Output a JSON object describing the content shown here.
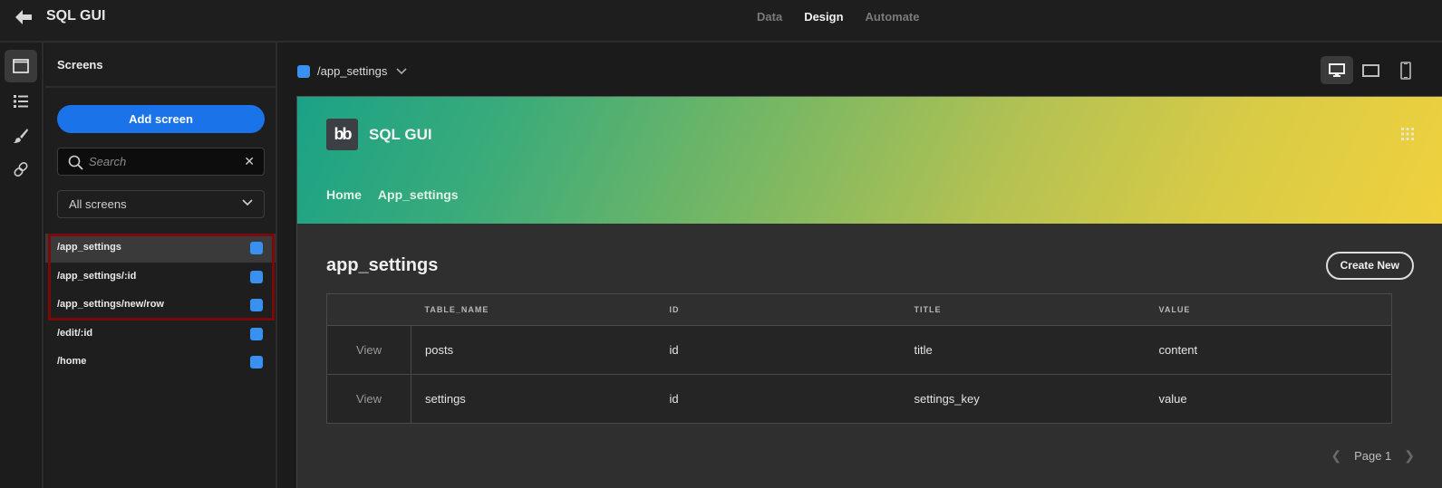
{
  "topbar": {
    "app_title": "SQL GUI",
    "tabs": [
      {
        "label": "Data",
        "active": false
      },
      {
        "label": "Design",
        "active": true
      },
      {
        "label": "Automate",
        "active": false
      }
    ]
  },
  "icon_rail": [
    "screens-icon",
    "components-list-icon",
    "theme-brush-icon",
    "link-icon"
  ],
  "screens_panel": {
    "title": "Screens",
    "add_button": "Add screen",
    "search": {
      "placeholder": "Search",
      "value": ""
    },
    "filter": {
      "selected": "All screens"
    },
    "screens": [
      {
        "route": "/app_settings",
        "selected": true
      },
      {
        "route": "/app_settings/:id",
        "selected": false
      },
      {
        "route": "/app_settings/new/row",
        "selected": false
      },
      {
        "route": "/edit/:id",
        "selected": false
      },
      {
        "route": "/home",
        "selected": false
      }
    ],
    "accent_color": "#3891f0",
    "highlight_color": "#7a0a0a"
  },
  "canvas": {
    "current_route": "/app_settings",
    "device_modes": [
      "desktop",
      "tablet",
      "mobile"
    ],
    "active_device": "desktop"
  },
  "preview": {
    "logo_text": "bb",
    "nav_title": "SQL GUI",
    "nav_links": [
      "Home",
      "App_settings"
    ],
    "page_title": "app_settings",
    "create_button": "Create New",
    "table": {
      "columns": [
        "",
        "TABLE_NAME",
        "ID",
        "TITLE",
        "VALUE"
      ],
      "rows": [
        {
          "action": "View",
          "table_name": "posts",
          "id": "id",
          "title": "title",
          "value": "content"
        },
        {
          "action": "View",
          "table_name": "settings",
          "id": "id",
          "title": "settings_key",
          "value": "value"
        }
      ]
    },
    "pagination": {
      "label": "Page 1"
    }
  }
}
